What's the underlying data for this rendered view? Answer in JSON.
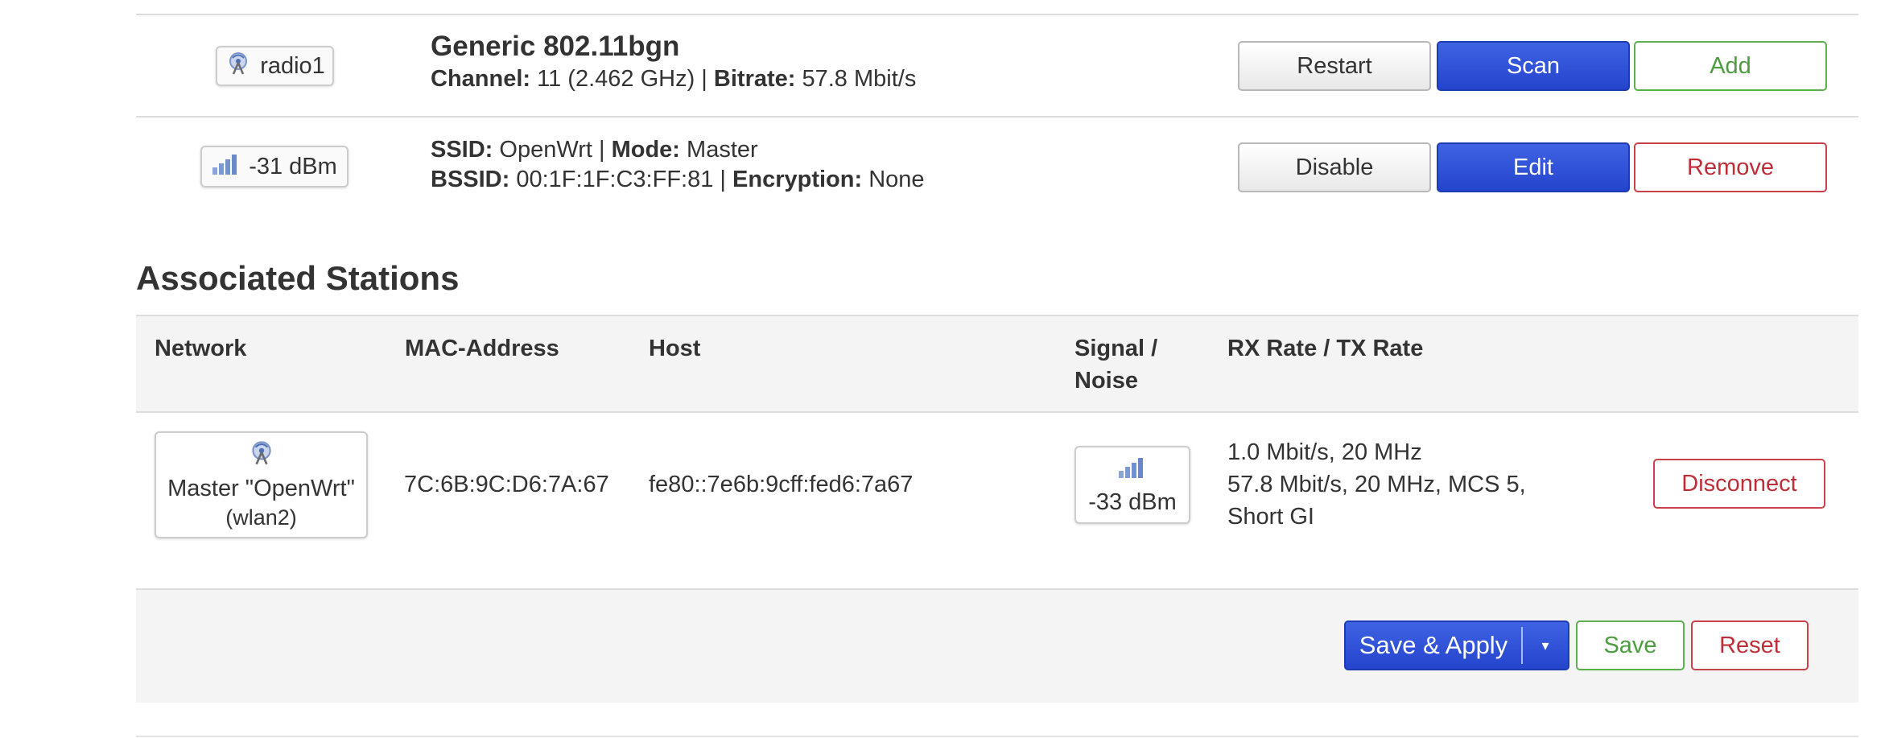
{
  "device": {
    "badge_label": "radio1",
    "name": "Generic 802.11bgn",
    "channel_label": "Channel:",
    "channel_value": "11 (2.462 GHz)",
    "sep1": "|",
    "bitrate_label": "Bitrate:",
    "bitrate_value": "57.8 Mbit/s",
    "buttons": {
      "restart": "Restart",
      "scan": "Scan",
      "add": "Add"
    }
  },
  "network": {
    "badge_label": "-31 dBm",
    "ssid_label": "SSID:",
    "ssid_value": "OpenWrt",
    "sep1": "|",
    "mode_label": "Mode:",
    "mode_value": "Master",
    "bssid_label": "BSSID:",
    "bssid_value": "00:1F:1F:C3:FF:81",
    "sep2": "|",
    "encryption_label": "Encryption:",
    "encryption_value": "None",
    "buttons": {
      "disable": "Disable",
      "edit": "Edit",
      "remove": "Remove"
    }
  },
  "stations": {
    "title": "Associated Stations",
    "headers": {
      "network": "Network",
      "mac": "MAC-Address",
      "host": "Host",
      "signal_line1": "Signal /",
      "signal_line2": "Noise",
      "rate": "RX Rate / TX Rate"
    },
    "rows": [
      {
        "network_line1": "Master \"OpenWrt\"",
        "network_line2": "(wlan2)",
        "mac": "7C:6B:9C:D6:7A:67",
        "host": "fe80::7e6b:9cff:fed6:7a67",
        "signal": "-33 dBm",
        "rx": "1.0 Mbit/s, 20 MHz",
        "tx_line1": "57.8 Mbit/s, 20 MHz, MCS 5,",
        "tx_line2": "Short GI",
        "action": "Disconnect"
      }
    ]
  },
  "footer": {
    "save_apply": "Save & Apply",
    "caret": "▾",
    "save": "Save",
    "reset": "Reset"
  },
  "colors": {
    "primary": "#2b4bd6",
    "positive": "#4a9e3e",
    "negative": "#bd2e38",
    "signal_bars": "#6f8fd0"
  },
  "icons": {
    "device_icon": "wifi-radio-icon",
    "signal_icon": "signal-bars-icon"
  }
}
